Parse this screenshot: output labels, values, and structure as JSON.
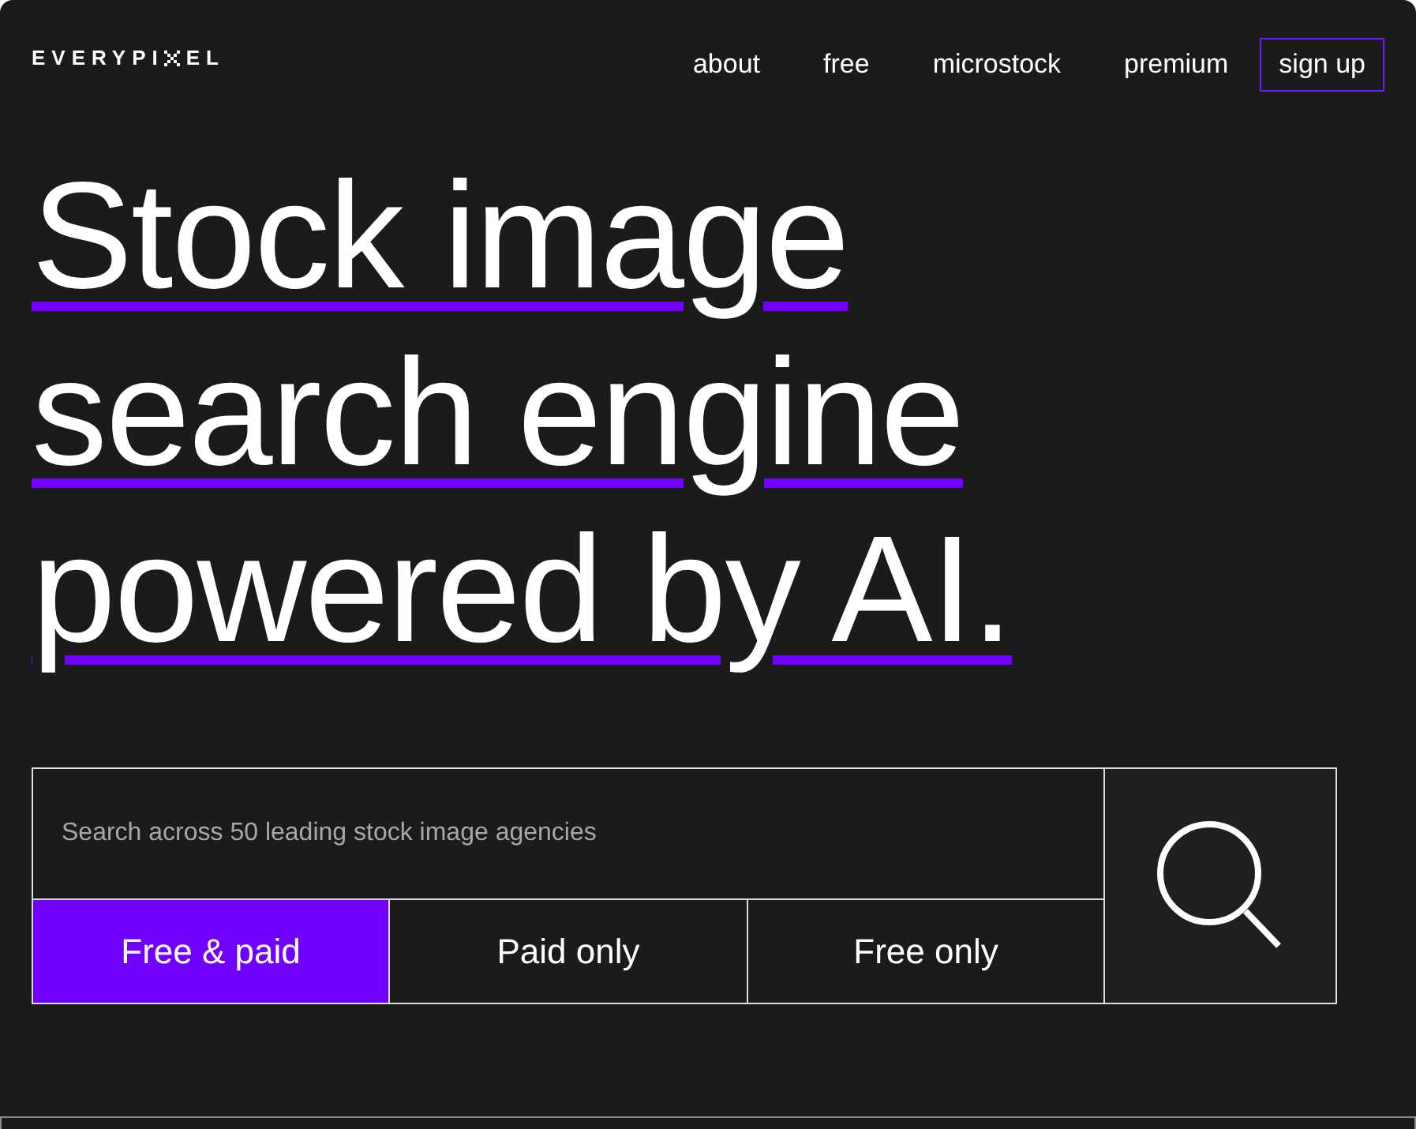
{
  "logo": {
    "before": "EVERYPI",
    "after": "EL"
  },
  "nav": [
    {
      "label": "about",
      "kind": "link"
    },
    {
      "label": "free",
      "kind": "link"
    },
    {
      "label": "microstock",
      "kind": "link"
    },
    {
      "label": "premium",
      "kind": "link"
    },
    {
      "label": "sign up",
      "kind": "outlined"
    }
  ],
  "headline": [
    "Stock image",
    "search engine",
    "powered by AI."
  ],
  "search": {
    "placeholder": "Search across 50 leading stock image agencies"
  },
  "filters": [
    {
      "label": "Free & paid",
      "selected": true
    },
    {
      "label": "Paid only",
      "selected": false
    },
    {
      "label": "Free only",
      "selected": false
    }
  ]
}
